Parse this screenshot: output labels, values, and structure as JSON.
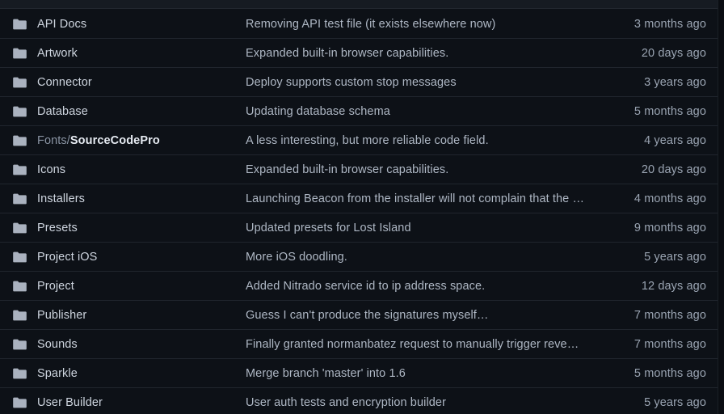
{
  "theme": {
    "background": "#0d1117",
    "row_separator": "#20252d",
    "name_color": "#cdd4de",
    "message_color": "#aeb7c4",
    "time_color": "#9aa4b2",
    "folder_icon_color": "#aab2bf",
    "top_sliver_background": "#161b22",
    "gutter_background": "#0a0d12"
  },
  "file_list": {
    "icon_name": "folder-icon",
    "rows": [
      {
        "name": "API Docs",
        "name_prefix": "",
        "name_leaf": "API Docs",
        "message": "Removing API test file (it exists elsewhere now)",
        "time": "3 months ago"
      },
      {
        "name": "Artwork",
        "name_prefix": "",
        "name_leaf": "Artwork",
        "message": "Expanded built-in browser capabilities.",
        "time": "20 days ago"
      },
      {
        "name": "Connector",
        "name_prefix": "",
        "name_leaf": "Connector",
        "message": "Deploy supports custom stop messages",
        "time": "3 years ago"
      },
      {
        "name": "Database",
        "name_prefix": "",
        "name_leaf": "Database",
        "message": "Updating database schema",
        "time": "5 months ago"
      },
      {
        "name": "Fonts/SourceCodePro",
        "name_prefix": "Fonts/",
        "name_leaf": "SourceCodePro",
        "message": "A less interesting, but more reliable code field.",
        "time": "4 years ago"
      },
      {
        "name": "Icons",
        "name_prefix": "",
        "name_leaf": "Icons",
        "message": "Expanded built-in browser capabilities.",
        "time": "20 days ago"
      },
      {
        "name": "Installers",
        "name_prefix": "",
        "name_leaf": "Installers",
        "message": "Launching Beacon from the installer will not complain that the instal…",
        "time": "4 months ago"
      },
      {
        "name": "Presets",
        "name_prefix": "",
        "name_leaf": "Presets",
        "message": "Updated presets for Lost Island",
        "time": "9 months ago"
      },
      {
        "name": "Project iOS",
        "name_prefix": "",
        "name_leaf": "Project iOS",
        "message": "More iOS doodling.",
        "time": "5 years ago"
      },
      {
        "name": "Project",
        "name_prefix": "",
        "name_leaf": "Project",
        "message": "Added Nitrado service id to ip address space.",
        "time": "12 days ago"
      },
      {
        "name": "Publisher",
        "name_prefix": "",
        "name_leaf": "Publisher",
        "message": "Guess I can't produce the signatures myself…",
        "time": "7 months ago"
      },
      {
        "name": "Sounds",
        "name_prefix": "",
        "name_leaf": "Sounds",
        "message": "Finally granted normanbatez request to manually trigger revenge mode.",
        "time": "7 months ago"
      },
      {
        "name": "Sparkle",
        "name_prefix": "",
        "name_leaf": "Sparkle",
        "message": "Merge branch 'master' into 1.6",
        "time": "5 months ago"
      },
      {
        "name": "User Builder",
        "name_prefix": "",
        "name_leaf": "User Builder",
        "message": "User auth tests and encryption builder",
        "time": "5 years ago"
      }
    ]
  }
}
